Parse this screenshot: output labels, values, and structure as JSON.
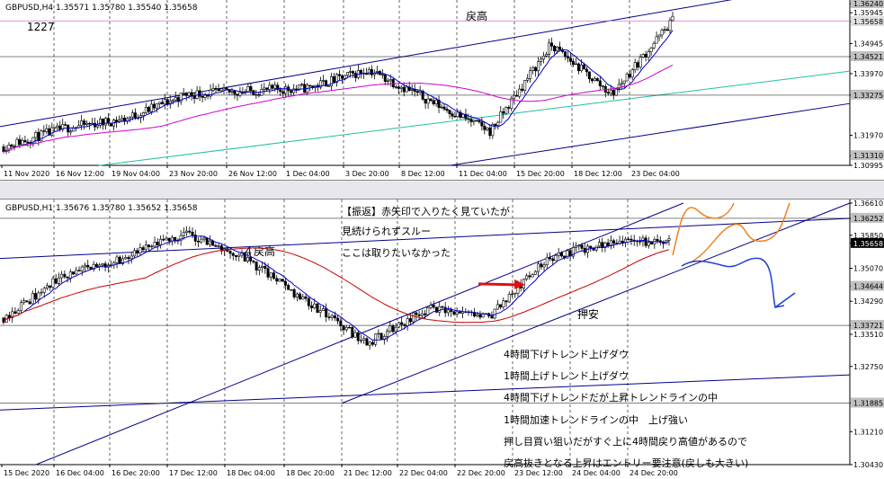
{
  "h4": {
    "header": "GBPUSD,H4  1.35571 1.35780 1.35540 1.35658",
    "annotation_1227": "1227",
    "annotation_modoritaka": "戻高",
    "price_labels": [
      "1.36240",
      "1.35945",
      "1.35658",
      "1.34945",
      "1.34521",
      "1.33970",
      "1.33275",
      "1.31970",
      "1.31310",
      "1.30995"
    ],
    "time_labels": [
      "11 Nov 2020",
      "16 Nov 12:00",
      "19 Nov 04:00",
      "23 Nov 20:00",
      "26 Nov 12:00",
      "1 Dec 04:00",
      "3 Dec 20:00",
      "8 Dec 12:00",
      "11 Dec 04:00",
      "15 Dec 20:00",
      "18 Dec 12:00",
      "23 Dec 04:00"
    ],
    "colors": {
      "candle": "#000000",
      "ma_fast": "#0000c8",
      "ma_slow": "#d000d0",
      "channel": "#00008b",
      "teal": "#20c0a0"
    }
  },
  "h1": {
    "header": "GBPUSD,H1  1.35676 1.35780 1.35652 1.35658",
    "annotation_yon_modoritaka": "４戻高",
    "annotation_oshiyasu": "押安",
    "notes": [
      "【振返】赤矢印で入りたく見ていたが",
      "見続けられずスルー",
      "ここは取りたいなかった",
      "4時間下げトレンド上げダウ",
      "1時間上げトレンド上げダウ",
      "4時間下げトレンドだが上昇トレンドラインの中",
      "1時間加速トレンドラインの中　上げ強い",
      "押し目買い狙いだがすぐ上に4時間戻り高値があるので",
      "戻高抜きとなる上昇はエントリー要注意(戻しも大きい)"
    ],
    "price_labels": [
      "1.36610",
      "1.36252",
      "1.35850",
      "1.35658",
      "1.35070",
      "1.34644",
      "1.34290",
      "1.33721",
      "1.33510",
      "1.32750",
      "1.31885",
      "1.31210",
      "1.30430"
    ],
    "time_labels": [
      "15 Dec 2020",
      "16 Dec 04:00",
      "16 Dec 20:00",
      "17 Dec 12:00",
      "18 Dec 04:00",
      "18 Dec 20:00",
      "21 Dec 12:00",
      "22 Dec 04:00",
      "22 Dec 20:00",
      "23 Dec 12:00",
      "24 Dec 04:00",
      "24 Dec 20:00"
    ],
    "colors": {
      "candle": "#000000",
      "ma_fast": "#0000c8",
      "ma_slow": "#c80000",
      "channel": "#00008b",
      "arrow": "#e01010",
      "orange": "#f08020",
      "blue_draw": "#2040d0"
    }
  },
  "chart_data": [
    {
      "type": "candlestick",
      "title": "GBPUSD,H4",
      "ohlc_last": {
        "open": 1.35571,
        "high": 1.3578,
        "low": 1.3554,
        "close": 1.35658
      },
      "ylim": [
        1.30995,
        1.3624
      ],
      "x": [
        "11 Nov 2020",
        "16 Nov 12:00",
        "19 Nov 04:00",
        "23 Nov 20:00",
        "26 Nov 12:00",
        "1 Dec 04:00",
        "3 Dec 20:00",
        "8 Dec 12:00",
        "11 Dec 04:00",
        "15 Dec 20:00",
        "18 Dec 12:00",
        "23 Dec 04:00"
      ],
      "y_close_approx": [
        1.316,
        1.322,
        1.325,
        1.333,
        1.334,
        1.335,
        1.341,
        1.331,
        1.321,
        1.349,
        1.333,
        1.357
      ],
      "grid": true
    },
    {
      "type": "candlestick",
      "title": "GBPUSD,H1",
      "ohlc_last": {
        "open": 1.35676,
        "high": 1.3578,
        "low": 1.35652,
        "close": 1.35658
      },
      "ylim": [
        1.3043,
        1.3661
      ],
      "x": [
        "15 Dec 2020",
        "16 Dec 04:00",
        "16 Dec 20:00",
        "17 Dec 12:00",
        "18 Dec 04:00",
        "18 Dec 20:00",
        "21 Dec 12:00",
        "22 Dec 04:00",
        "22 Dec 20:00",
        "23 Dec 12:00",
        "24 Dec 04:00",
        "24 Dec 20:00"
      ],
      "y_close_approx": [
        1.339,
        1.349,
        1.353,
        1.359,
        1.353,
        1.343,
        1.333,
        1.341,
        1.339,
        1.353,
        1.357,
        1.357
      ],
      "grid": true
    }
  ]
}
